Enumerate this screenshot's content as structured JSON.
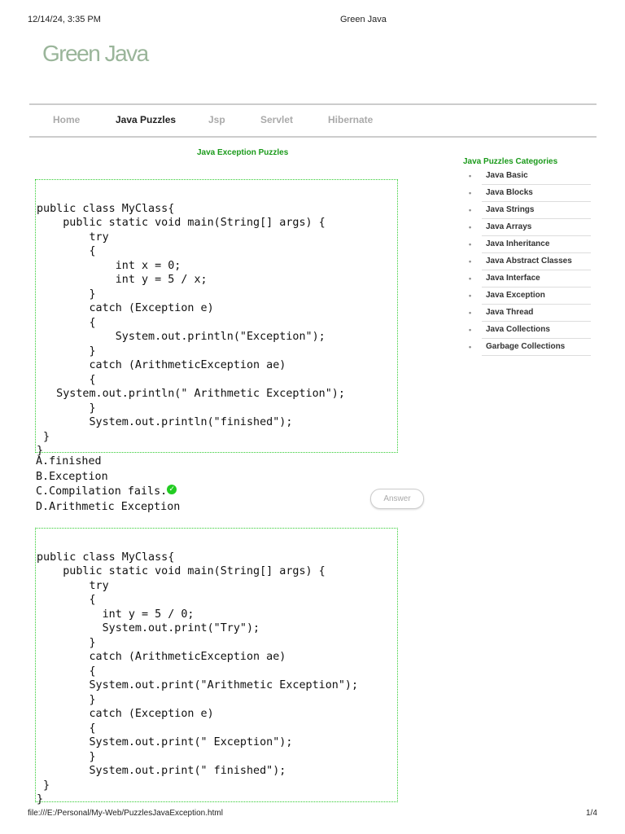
{
  "print_header": {
    "datetime": "12/14/24, 3:35 PM",
    "title": "Green Java"
  },
  "site": {
    "logo": "Green Java"
  },
  "nav": [
    "Home",
    "Java Puzzles",
    "Jsp",
    "Servlet",
    "Hibernate"
  ],
  "page_title": "Java Exception Puzzles",
  "puzzles": [
    {
      "code": [
        "",
        "public class MyClass{",
        "    public static void main(String[] args) {",
        "        try",
        "        {",
        "            int x = 0;",
        "            int y = 5 / x;",
        "        }",
        "        catch (Exception e)",
        "        {",
        "            System.out.println(\"Exception\");",
        "        }",
        "        catch (ArithmeticException ae)",
        "        {",
        "   System.out.println(\" Arithmetic Exception\");",
        "        }",
        "        System.out.println(\"finished\");",
        " }",
        "}"
      ],
      "options": [
        "A.finished",
        "B.Exception",
        "C.Compilation fails.",
        "D.Arithmetic Exception"
      ],
      "correct_index": 2,
      "answer_button": "Answer"
    },
    {
      "code": [
        "",
        "public class MyClass{",
        "    public static void main(String[] args) {",
        "        try",
        "        {",
        "          int y = 5 / 0;",
        "          System.out.print(\"Try\");",
        "        }",
        "        catch (ArithmeticException ae)",
        "        {",
        "        System.out.print(\"Arithmetic Exception\");",
        "        }",
        "        catch (Exception e)",
        "        {",
        "        System.out.print(\" Exception\");",
        "        }",
        "        System.out.print(\" finished\");",
        " }",
        "}"
      ]
    }
  ],
  "sidebar": {
    "title": "Java Puzzles Categories",
    "items": [
      "Java Basic",
      "Java Blocks",
      "Java Strings",
      "Java Arrays",
      "Java Inheritance",
      "Java Abstract Classes",
      "Java Interface",
      "Java Exception",
      "Java Thread",
      "Java Collections",
      "Garbage Collections"
    ]
  },
  "footer": {
    "url": "file:///E:/Personal/My-Web/PuzzlesJavaException.html",
    "page": "1/4"
  }
}
